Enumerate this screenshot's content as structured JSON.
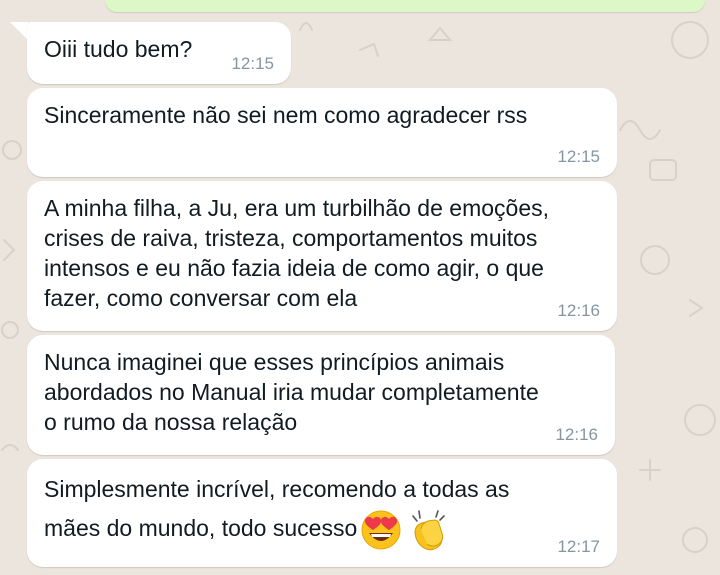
{
  "colors": {
    "wallpaper": "#ece5dd",
    "incoming_bubble": "#ffffff",
    "outgoing_bubble": "#dcf8c6",
    "timestamp": "#8696a0",
    "text": "#111b21"
  },
  "messages": [
    {
      "text": "Oiii tudo bem?",
      "time": "12:15"
    },
    {
      "text": "Sinceramente não sei nem como agradecer rss",
      "time": "12:15"
    },
    {
      "text": "A minha filha, a Ju, era um turbilhão de emoções,\ncrises de raiva, tristeza, comportamentos muitos\nintensos e eu não fazia ideia de como agir, o que\nfazer, como conversar com ela",
      "time": "12:16"
    },
    {
      "text": "Nunca imaginei que esses princípios animais\nabordados no Manual iria mudar completamente\no rumo da nossa relação",
      "time": "12:16"
    },
    {
      "text": "Simplesmente incrível, recomendo a todas as\nmães do mundo, todo sucesso",
      "time": "12:17",
      "emojis": [
        "heart-eyes-emoji",
        "clapping-hands-emoji"
      ]
    }
  ]
}
